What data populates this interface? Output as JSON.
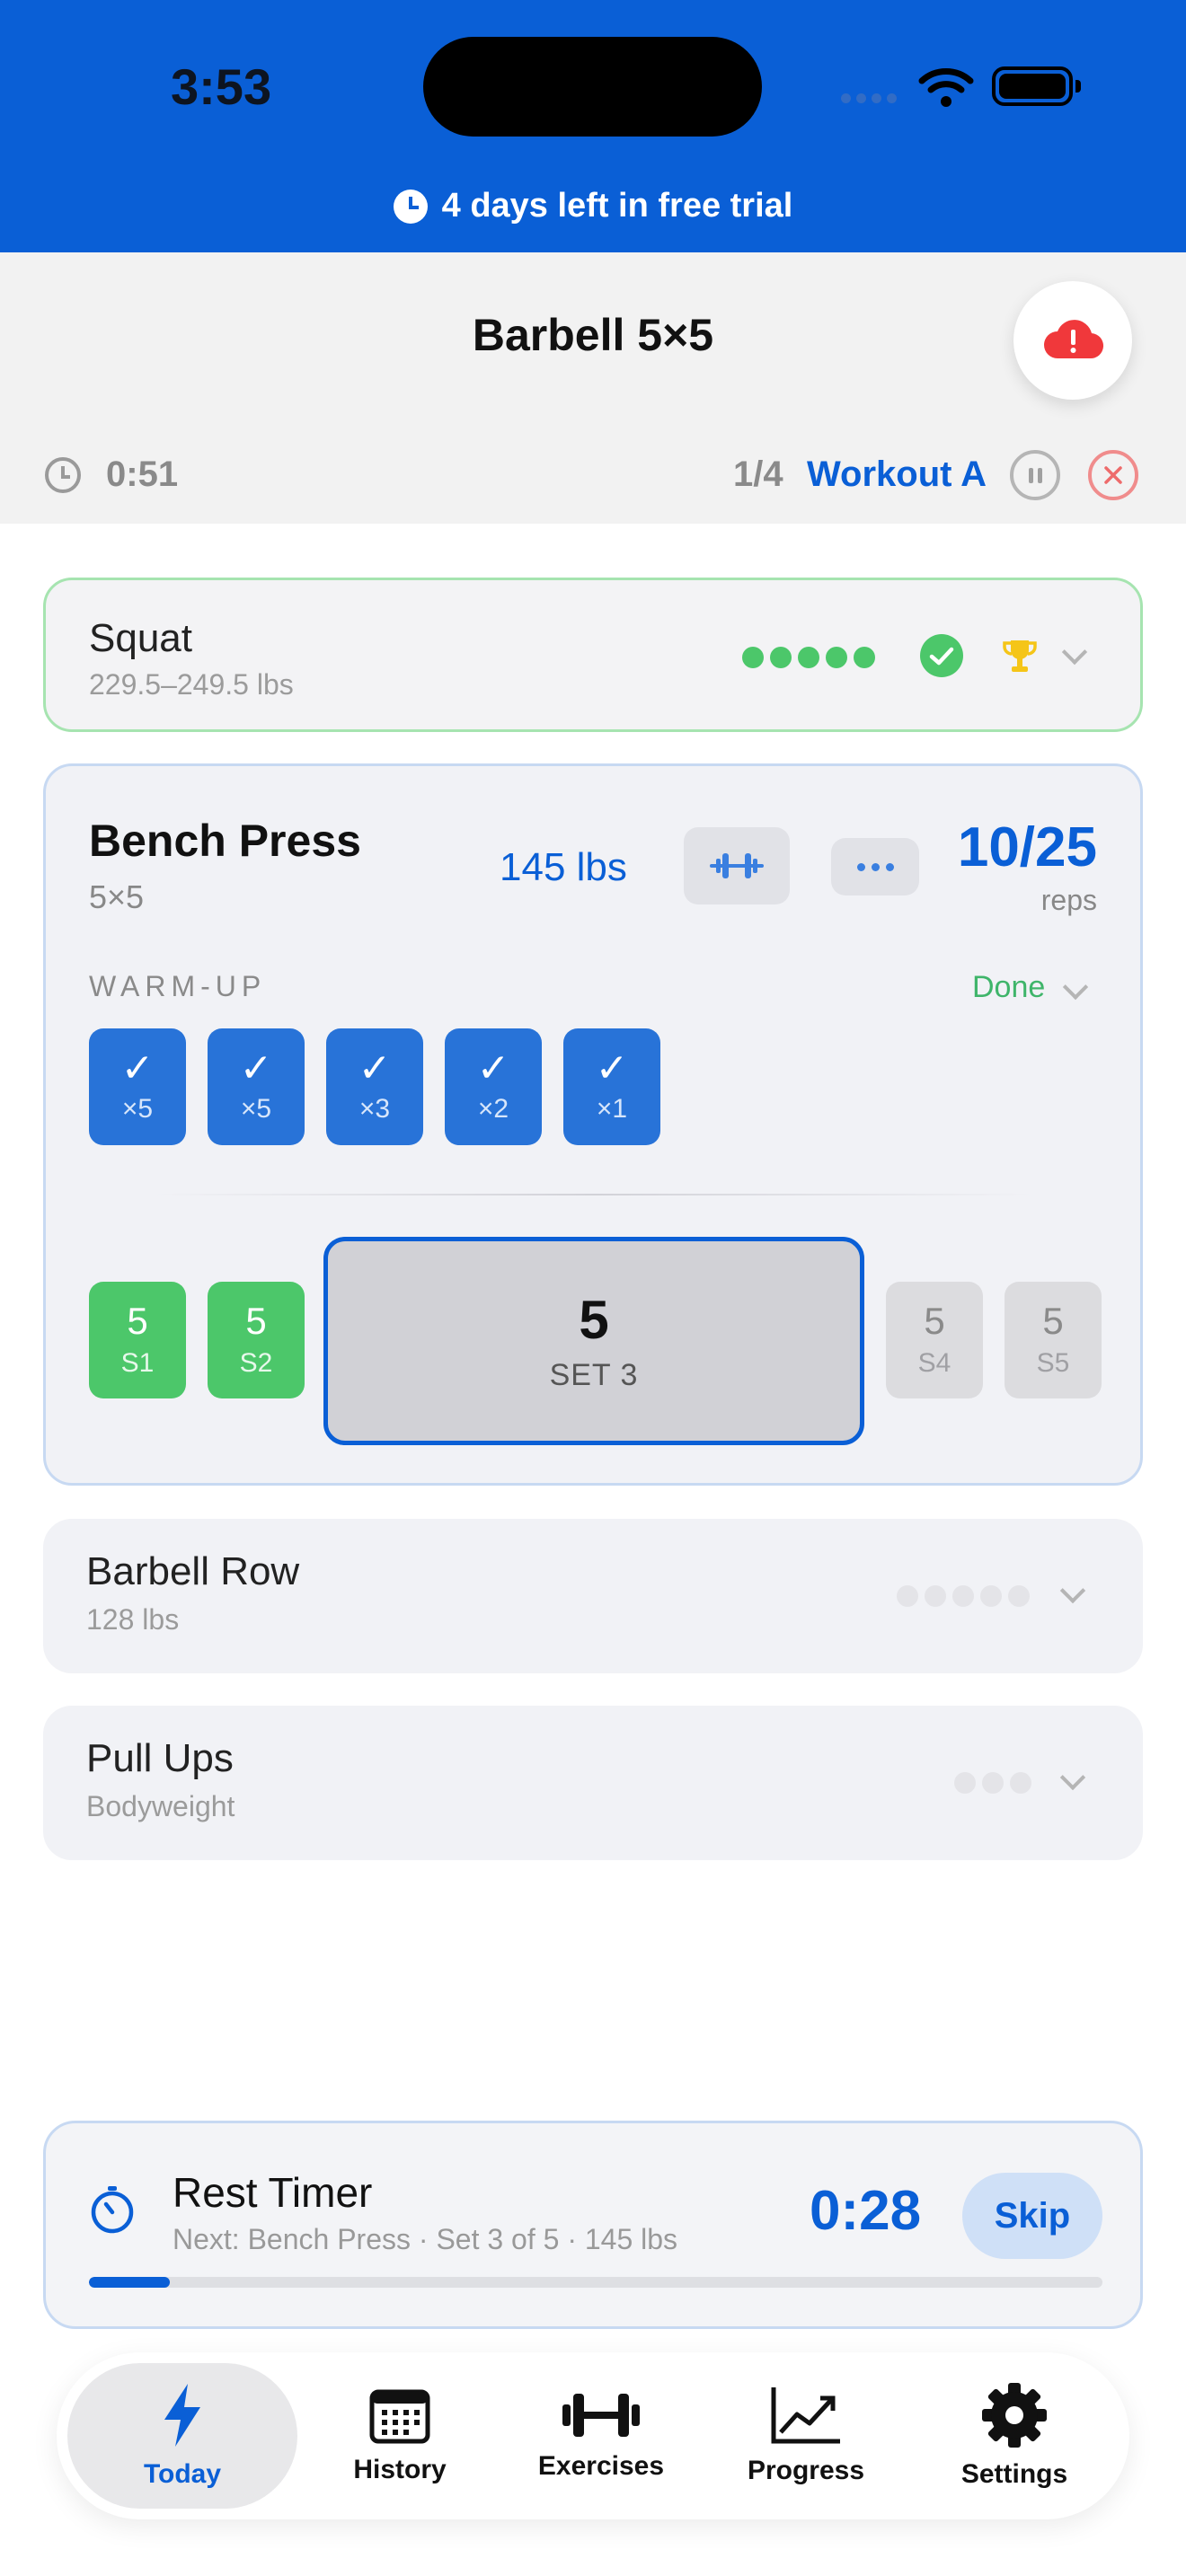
{
  "status_bar": {
    "time": "3:53"
  },
  "trial_banner": {
    "text": "4 days left in free trial"
  },
  "header": {
    "title": "Barbell 5×5",
    "elapsed": "0:51",
    "exercise_progress": "1/4",
    "workout_name": "Workout A"
  },
  "exercises": {
    "squat": {
      "name": "Squat",
      "sub": "229.5–249.5 lbs",
      "sets_completed": 5,
      "sets_total": 5
    },
    "bench": {
      "name": "Bench Press",
      "scheme": "5×5",
      "weight": "145 lbs",
      "reps_count": "10/25",
      "reps_label": "reps",
      "warmup_label": "WARM-UP",
      "warmup_status": "Done",
      "warmup_sets": [
        {
          "check": "✓",
          "reps": "×5"
        },
        {
          "check": "✓",
          "reps": "×5"
        },
        {
          "check": "✓",
          "reps": "×3"
        },
        {
          "check": "✓",
          "reps": "×2"
        },
        {
          "check": "✓",
          "reps": "×1"
        }
      ],
      "sets": [
        {
          "reps": "5",
          "label": "S1"
        },
        {
          "reps": "5",
          "label": "S2"
        },
        {
          "reps": "5",
          "label": "SET 3"
        },
        {
          "reps": "5",
          "label": "S4"
        },
        {
          "reps": "5",
          "label": "S5"
        }
      ]
    },
    "row": {
      "name": "Barbell Row",
      "sub": "128 lbs",
      "sets_total": 5
    },
    "pullups": {
      "name": "Pull Ups",
      "sub": "Bodyweight",
      "sets_total": 3
    }
  },
  "rest_timer": {
    "title": "Rest Timer",
    "next": "Next: Bench Press · Set 3 of 5 · 145 lbs",
    "remaining": "0:28",
    "skip_label": "Skip",
    "progress": 0.08
  },
  "tabs": [
    {
      "label": "Today",
      "icon": "bolt-icon"
    },
    {
      "label": "History",
      "icon": "calendar-icon"
    },
    {
      "label": "Exercises",
      "icon": "dumbbell-icon"
    },
    {
      "label": "Progress",
      "icon": "chart-icon"
    },
    {
      "label": "Settings",
      "icon": "gear-icon"
    }
  ],
  "colors": {
    "accent": "#0a5fd6",
    "success": "#4cc76a",
    "warning_cloud": "#f0383b"
  }
}
